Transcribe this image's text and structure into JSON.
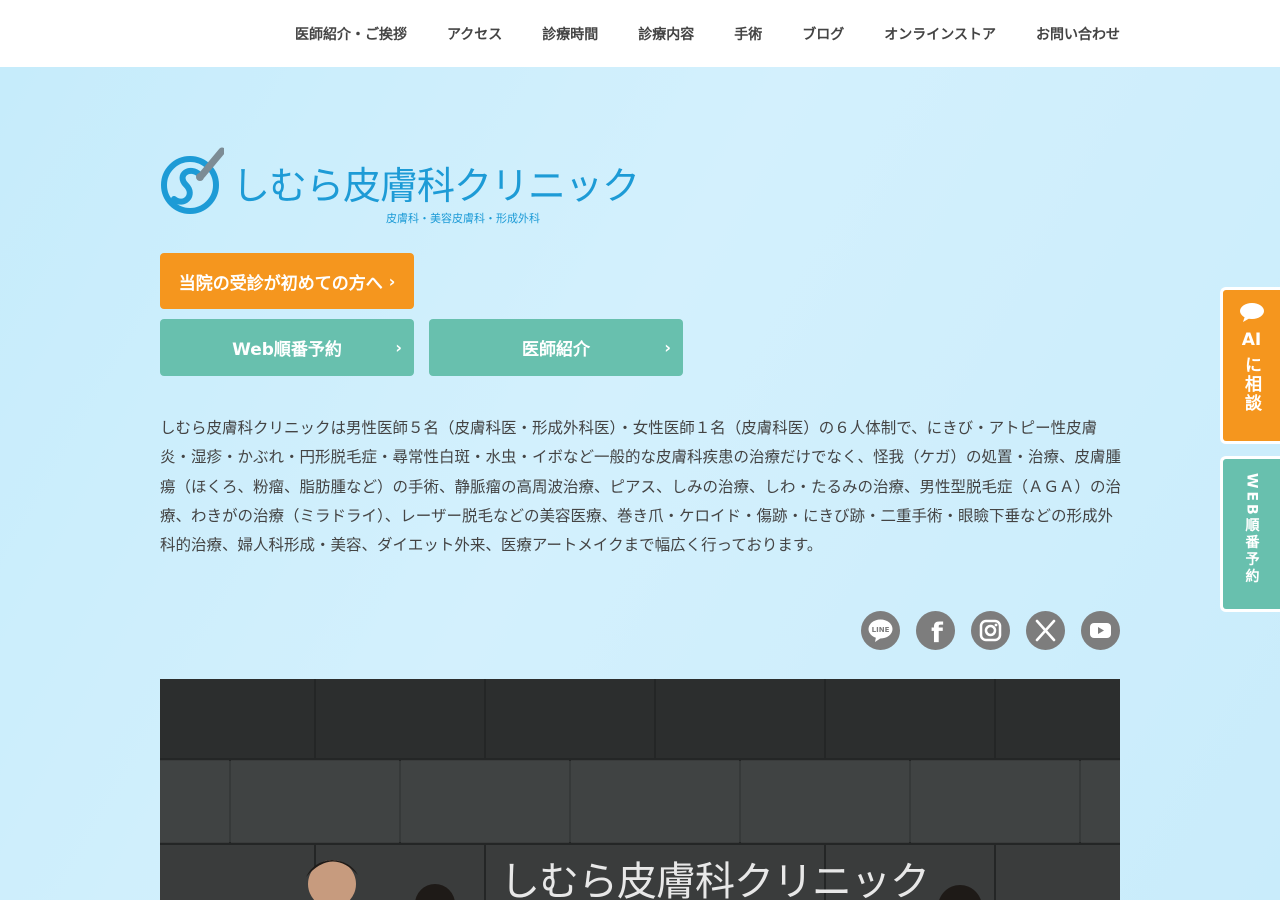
{
  "nav": {
    "items": [
      {
        "label": "医師紹介・ご挨拶"
      },
      {
        "label": "アクセス"
      },
      {
        "label": "診療時間"
      },
      {
        "label": "診療内容"
      },
      {
        "label": "手術"
      },
      {
        "label": "ブログ"
      },
      {
        "label": "オンラインストア"
      },
      {
        "label": "お問い合わせ"
      }
    ]
  },
  "logo": {
    "name": "しむら皮膚科クリニック",
    "subtitle": "皮膚科・美容皮膚科・形成外科"
  },
  "buttons": {
    "first_visit": "当院の受診が初めての方へ",
    "web_reservation": "Web順番予約",
    "doctor_intro": "医師紹介"
  },
  "intro_text": "しむら皮膚科クリニックは男性医師５名（皮膚科医・形成外科医）・女性医師１名（皮膚科医）の６人体制で、にきび・アトピー性皮膚炎・湿疹・かぶれ・円形脱毛症・尋常性白斑・水虫・イボなど一般的な皮膚科疾患の治療だけでなく、怪我（ケガ）の処置・治療、皮膚腫瘍（ほくろ、粉瘤、脂肪腫など）の手術、静脈瘤の高周波治療、ピアス、しみの治療、しわ・たるみの治療、男性型脱毛症（ＡＧＡ）の治療、わきがの治療（ミラドライ）、レーザー脱毛などの美容医療、巻き爪・ケロイド・傷跡・にきび跡・二重手術・眼瞼下垂などの形成外科的治療、婦人科形成・美容、ダイエット外来、医療アートメイクまで幅広く行っております。",
  "social": [
    {
      "icon": "line-icon",
      "label": "LINE"
    },
    {
      "icon": "facebook-icon",
      "label": "f"
    },
    {
      "icon": "instagram-icon",
      "label": ""
    },
    {
      "icon": "x-icon",
      "label": "X"
    },
    {
      "icon": "youtube-icon",
      "label": ""
    }
  ],
  "photo": {
    "sign_text": "しむら皮膚科クリニック"
  },
  "side_tabs": {
    "ai": "AIに相談",
    "ai_top": "AI",
    "ai_vertical": "に相談",
    "web": "WEB順番予約"
  },
  "colors": {
    "orange": "#f5961e",
    "teal": "#68c0ae",
    "brand_blue": "#1d9bd6",
    "background": "#cdeefc"
  }
}
